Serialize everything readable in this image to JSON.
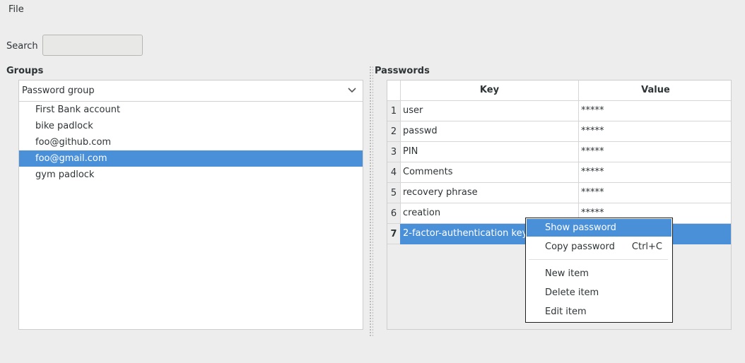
{
  "menubar": {
    "file": "File"
  },
  "search": {
    "label": "Search",
    "value": "",
    "placeholder": ""
  },
  "groups": {
    "label": "Groups",
    "combo_value": "Password group",
    "items": [
      "First Bank account",
      "bike padlock",
      "foo@github.com",
      "foo@gmail.com",
      "gym padlock"
    ],
    "selected_index": 3
  },
  "passwords": {
    "label": "Passwords",
    "columns": [
      "Key",
      "Value"
    ],
    "rows": [
      {
        "num": "1",
        "key": "user",
        "value": "*****"
      },
      {
        "num": "2",
        "key": "passwd",
        "value": "*****"
      },
      {
        "num": "3",
        "key": "PIN",
        "value": "*****"
      },
      {
        "num": "4",
        "key": "Comments",
        "value": "*****"
      },
      {
        "num": "5",
        "key": "recovery phrase",
        "value": "*****"
      },
      {
        "num": "6",
        "key": "creation",
        "value": "*****"
      },
      {
        "num": "7",
        "key": "2-factor-authentication key",
        "value": ""
      }
    ],
    "selected_row": 7
  },
  "context_menu": {
    "show_password": "Show password",
    "copy_password": "Copy password",
    "copy_shortcut": "Ctrl+C",
    "new_item": "New item",
    "delete_item": "Delete item",
    "edit_item": "Edit item"
  },
  "colors": {
    "selection": "#4a90d9",
    "background": "#ededed"
  }
}
